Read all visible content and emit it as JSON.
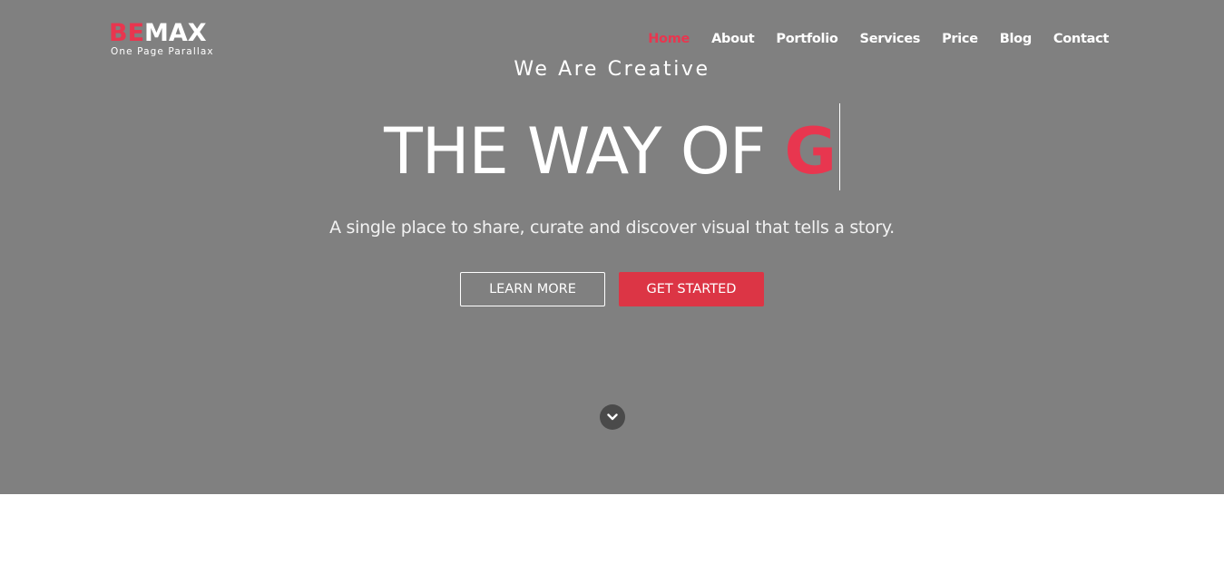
{
  "logo": {
    "accent": "BE",
    "rest": "MAX",
    "tagline": "One Page Parallax"
  },
  "nav": {
    "items": [
      "Home",
      "About",
      "Portfolio",
      "Services",
      "Price",
      "Blog",
      "Contact"
    ],
    "active": "Home"
  },
  "hero": {
    "subtitle": "We Are Creative",
    "headline_static": "THE WAY OF ",
    "headline_typed": "G",
    "tagline": "A single place to share, curate and discover visual that tells a story.",
    "learn_more": "LEARN MORE",
    "get_started": "GET STARTED",
    "scroll_icon": "chevron-down-icon"
  },
  "colors": {
    "accent": "#e8364f",
    "button_red": "#dc3545",
    "hero_bg": "#808080"
  }
}
